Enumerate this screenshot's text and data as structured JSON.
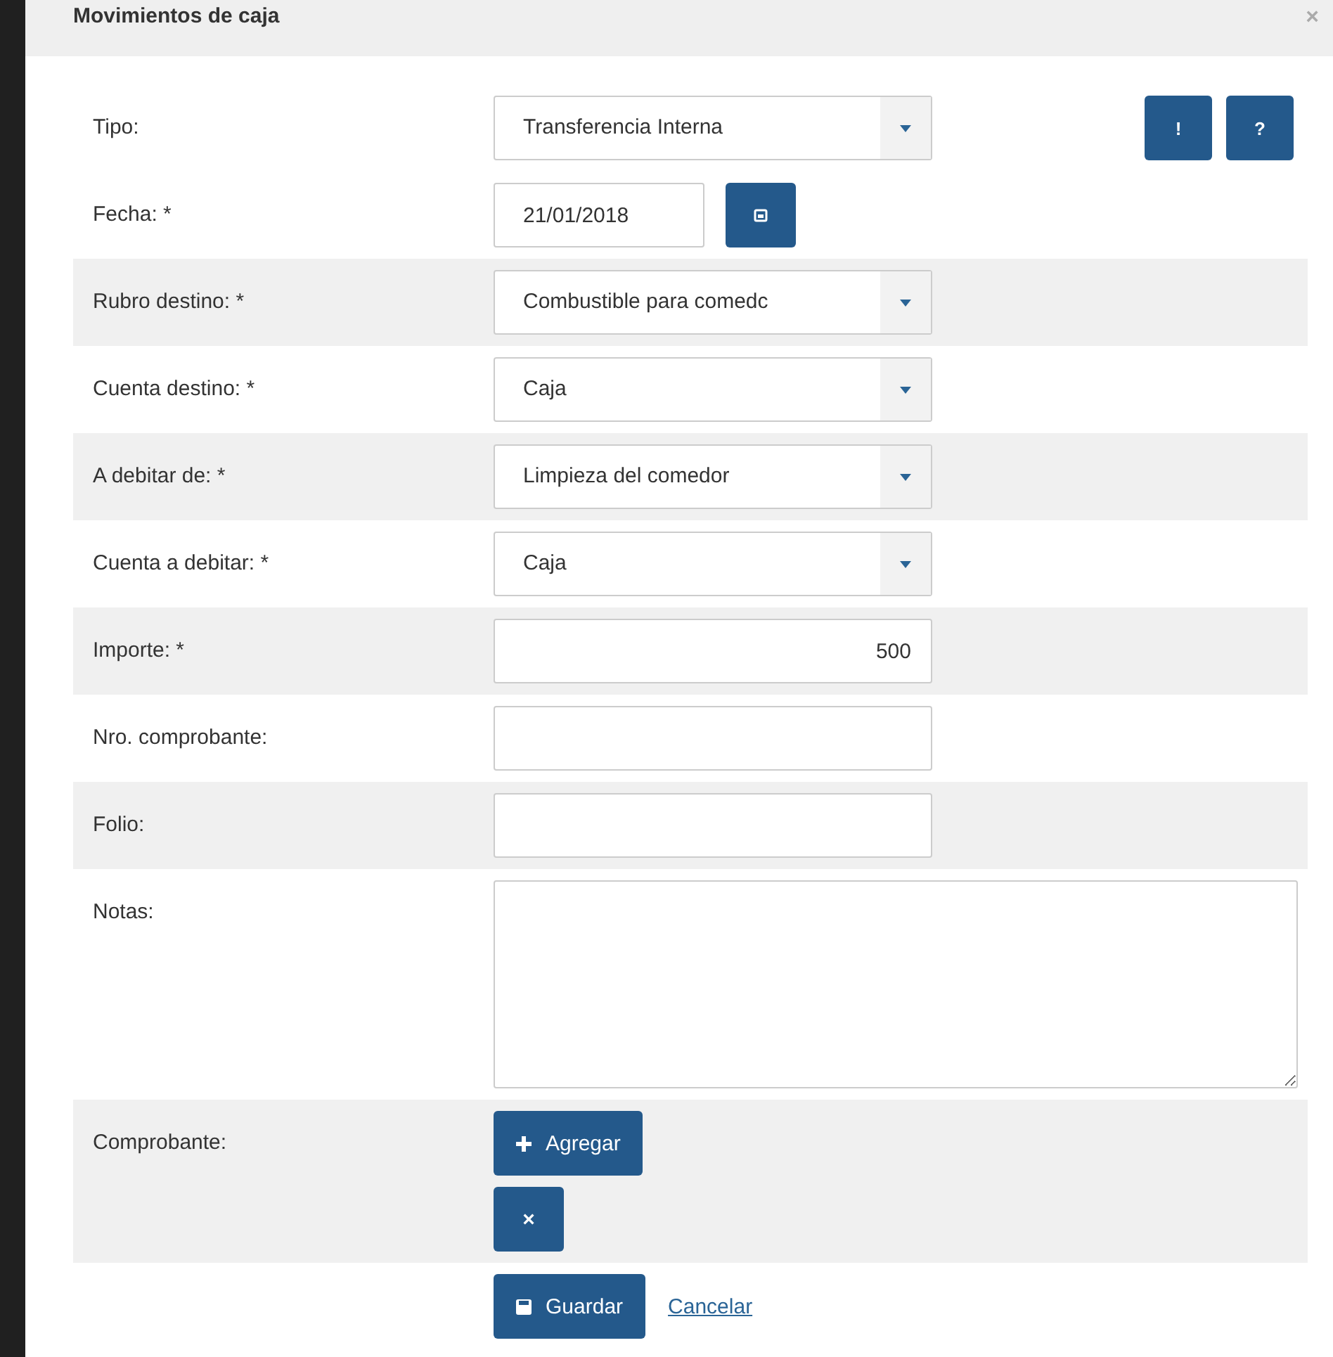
{
  "dialog": {
    "title": "Movimientos de caja",
    "close": "×"
  },
  "header_buttons": [
    {
      "label": "!"
    },
    {
      "label": "?"
    }
  ],
  "fields": [
    {
      "kind": "select",
      "label": "Tipo:",
      "value": "Transferencia Interna"
    },
    {
      "kind": "date",
      "label": "Fecha: *",
      "value": "21/01/2018"
    },
    {
      "kind": "select",
      "label": "Rubro destino: *",
      "value": "Combustible para comedc"
    },
    {
      "kind": "select",
      "label": "Cuenta destino: *",
      "value": "Caja"
    },
    {
      "kind": "select",
      "label": "A debitar de: *",
      "value": "Limpieza del comedor"
    },
    {
      "kind": "select",
      "label": "Cuenta a debitar: *",
      "value": "Caja"
    },
    {
      "kind": "number",
      "label": "Importe: *",
      "value": "500"
    },
    {
      "kind": "text",
      "label": "Nro. comprobante:"
    },
    {
      "kind": "text",
      "label": "Folio:"
    },
    {
      "kind": "textarea",
      "label": "Notas:"
    },
    {
      "kind": "upload",
      "label": "Comprobante:",
      "add": "Agregar",
      "remove": "×"
    }
  ],
  "actions": {
    "save": "Guardar",
    "cancel": "Cancelar"
  }
}
